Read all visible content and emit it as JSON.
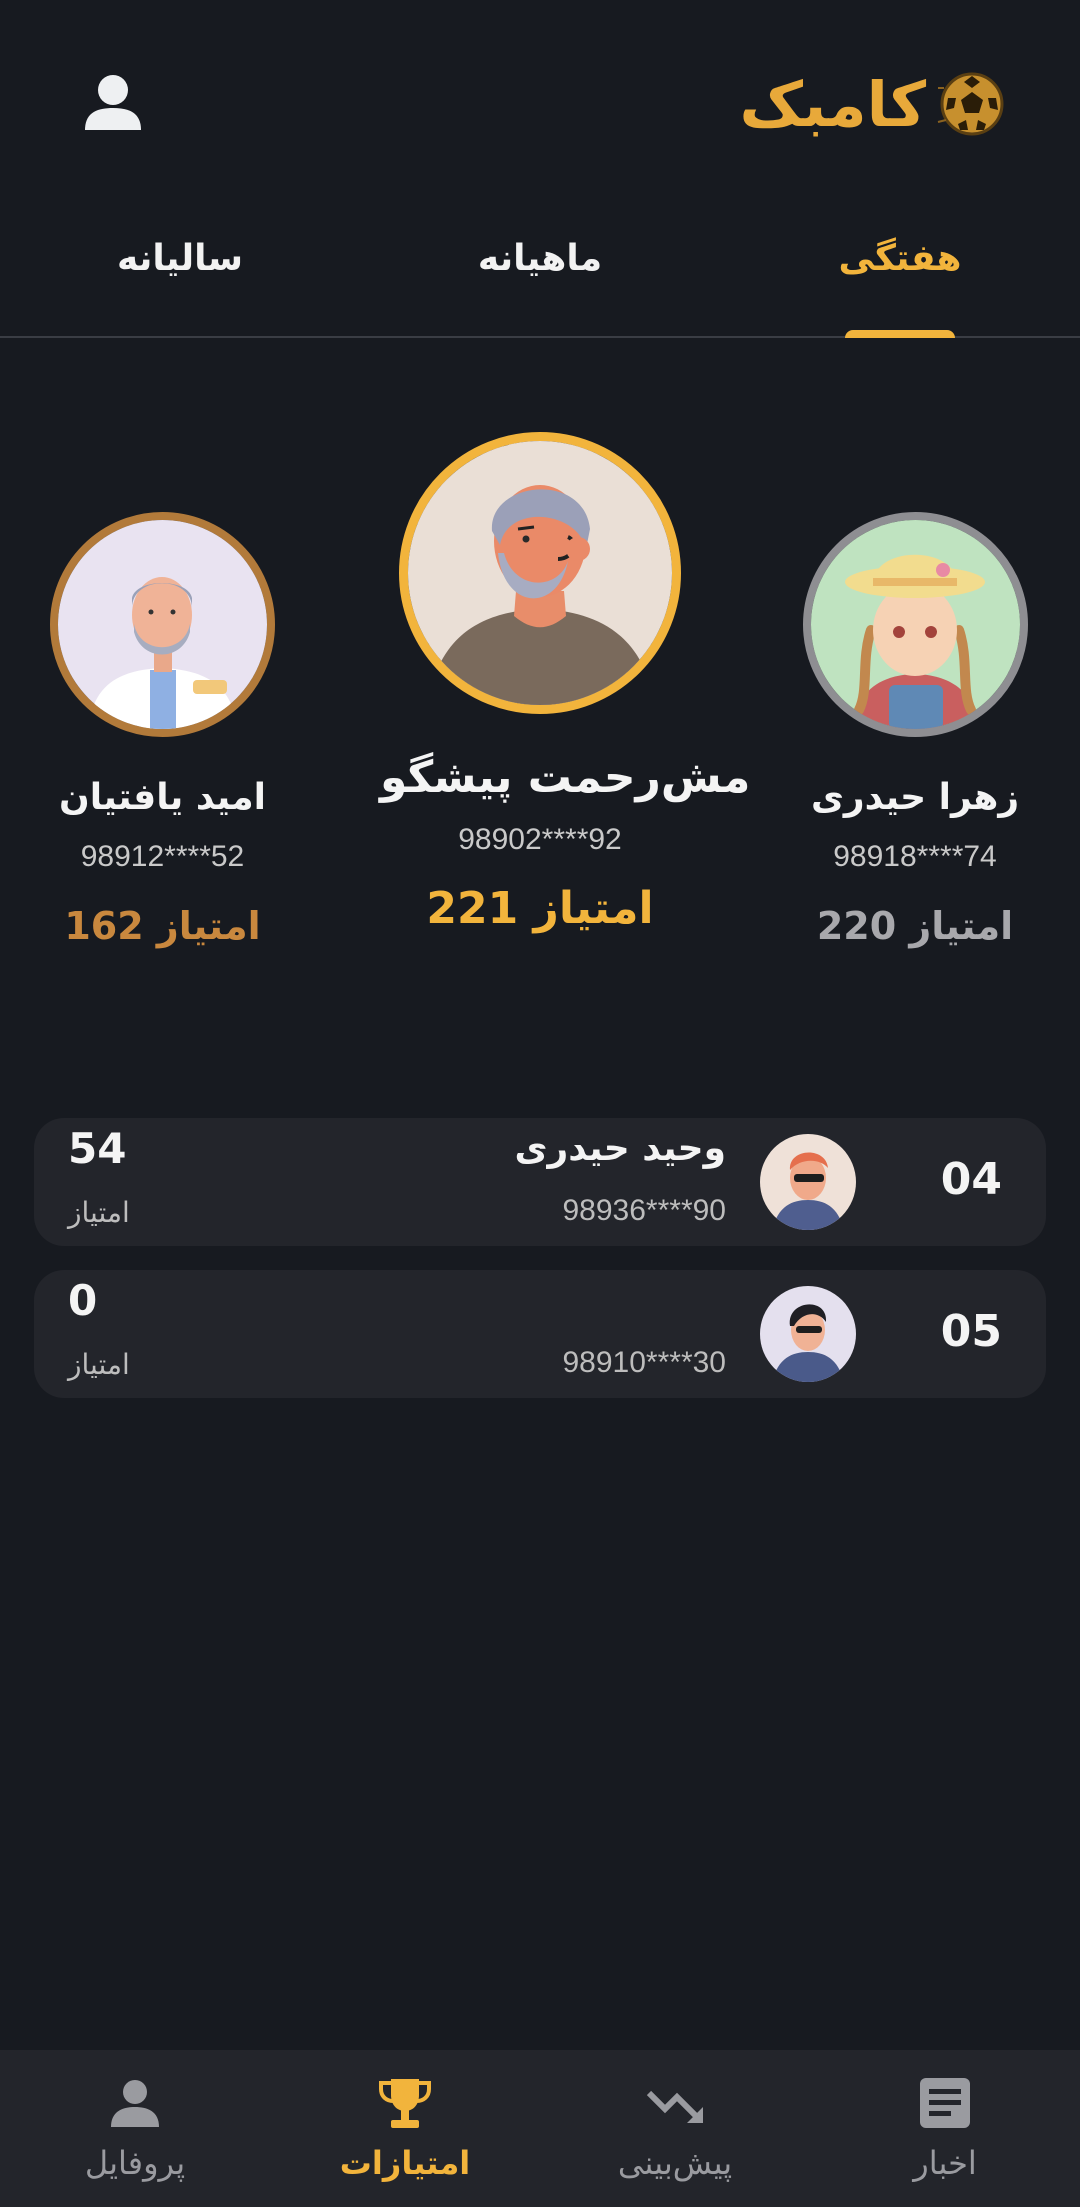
{
  "header": {
    "logo_text": "کامبک",
    "logo_icon": "soccer-ball-icon",
    "profile_icon": "user-icon"
  },
  "tabs": [
    {
      "label": "سالیانه",
      "active": false
    },
    {
      "label": "ماهیانه",
      "active": false
    },
    {
      "label": "هفتگی",
      "active": true
    }
  ],
  "podium": {
    "first": {
      "name": "مش‌رحمت پیشگو",
      "phone": "98902****92",
      "score": "221 امتیاز",
      "rank": 1
    },
    "second": {
      "name": "زهرا حیدری",
      "phone": "98918****74",
      "score": "220 امتیاز",
      "rank": 2
    },
    "third": {
      "name": "امید یافتیان",
      "phone": "98912****52",
      "score": "162 امتیاز",
      "rank": 3
    }
  },
  "list": [
    {
      "rank": "04",
      "name": "وحید حیدری",
      "phone": "98936****90",
      "points": "54",
      "points_label": "امتیاز"
    },
    {
      "rank": "05",
      "name": "",
      "phone": "98910****30",
      "points": "0",
      "points_label": "امتیاز"
    }
  ],
  "bottom_nav": [
    {
      "label": "پروفایل",
      "icon": "user-icon",
      "active": false
    },
    {
      "label": "امتیازات",
      "icon": "trophy-icon",
      "active": true
    },
    {
      "label": "پیش‌بینی",
      "icon": "trending-icon",
      "active": false
    },
    {
      "label": "اخبار",
      "icon": "news-icon",
      "active": false
    }
  ],
  "colors": {
    "background": "#171a20",
    "accent": "#f2b43c",
    "bronze": "#b27a3a",
    "silver": "#8e8e92",
    "card": "#23252b"
  }
}
